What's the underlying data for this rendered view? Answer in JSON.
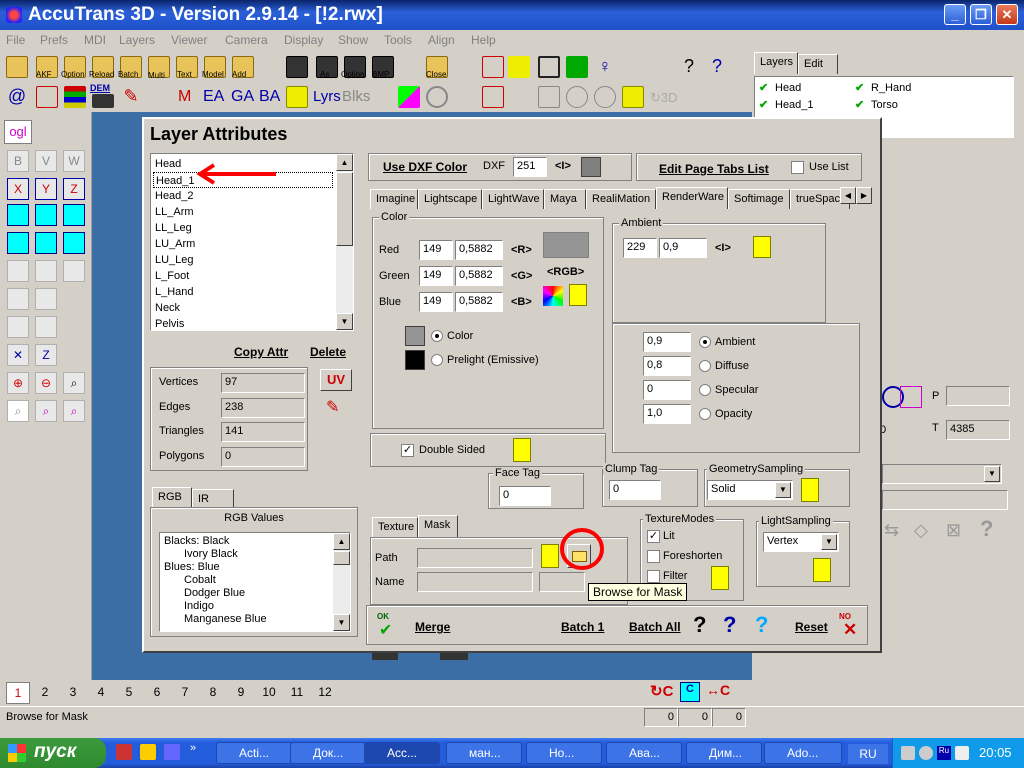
{
  "app": {
    "title": "AccuTrans 3D - Version 2.9.14 - [!2.rwx]",
    "menu": [
      "File",
      "Prefs",
      "MDI",
      "Layers",
      "Viewer",
      "Camera",
      "Display",
      "Show",
      "Tools",
      "Align",
      "Help"
    ],
    "toolbar_labels": [
      "AKF",
      "Option",
      "Reload",
      "Batch",
      "Multi",
      "Text",
      "Model",
      "Add",
      "As",
      "Option",
      "BMP",
      "Close"
    ],
    "toolbar_row2_text": [
      "DEM",
      "EA",
      "GA",
      "BA",
      "Lyrs",
      "Blks"
    ],
    "ogl_label": "ogl"
  },
  "right_panel": {
    "tabs": [
      "Layers",
      "Edit"
    ],
    "layers": [
      {
        "name": "Head",
        "checked": true
      },
      {
        "name": "R_Hand",
        "checked": true
      },
      {
        "name": "Head_1",
        "checked": true
      },
      {
        "name": "Torso",
        "checked": true
      }
    ],
    "p_label": "P",
    "t_label": "T",
    "t_value": "4385",
    "zero_value": "0"
  },
  "dialog": {
    "title": "Layer Attributes",
    "layer_list": [
      "Head",
      "Head_1",
      "Head_2",
      "LL_Arm",
      "LL_Leg",
      "LU_Arm",
      "LU_Leg",
      "L_Foot",
      "L_Hand",
      "Neck",
      "Pelvis"
    ],
    "selected_layer": "Head_1",
    "copy_attr": "Copy Attr",
    "delete": "Delete",
    "uv_label": "UV",
    "stats": [
      {
        "label": "Vertices",
        "value": "97"
      },
      {
        "label": "Edges",
        "value": "238"
      },
      {
        "label": "Triangles",
        "value": "141"
      },
      {
        "label": "Polygons",
        "value": "0"
      }
    ],
    "color_tabs": [
      "RGB",
      "IR"
    ],
    "rgb_values_title": "RGB Values",
    "rgb_list": [
      {
        "text": "Blacks: Black",
        "indent": false
      },
      {
        "text": "Ivory Black",
        "indent": true
      },
      {
        "text": "Blues: Blue",
        "indent": false
      },
      {
        "text": "Cobalt",
        "indent": true
      },
      {
        "text": "Dodger Blue",
        "indent": true
      },
      {
        "text": "Indigo",
        "indent": true
      },
      {
        "text": "Manganese Blue",
        "indent": true
      }
    ],
    "use_dxf_color": "Use DXF Color",
    "dxf_label": "DXF",
    "dxf_value": "251",
    "dxf_arrow": "<I>",
    "edit_page_tabs": "Edit Page Tabs List",
    "use_list": "Use List",
    "format_tabs": [
      "Imagine",
      "Lightscape",
      "LightWave",
      "Maya",
      "RealiMation",
      "RenderWare",
      "Softimage",
      "trueSpac"
    ],
    "active_format_tab": "RenderWare",
    "color_group": {
      "title": "Color",
      "rows": [
        {
          "label": "Red",
          "int": "149",
          "float": "0,5882",
          "btn": "<R>"
        },
        {
          "label": "Green",
          "int": "149",
          "float": "0,5882",
          "btn": "<G>"
        },
        {
          "label": "Blue",
          "int": "149",
          "float": "0,5882",
          "btn": "<B>"
        }
      ],
      "rgb_btn": "<RGB>",
      "swatch_color": "#959595",
      "radio_color": "Color",
      "radio_prelight": "Prelight (Emissive)"
    },
    "ambient_group": {
      "title": "Ambient",
      "int": "229",
      "float": "0,9",
      "btn": "<I>"
    },
    "material": [
      {
        "value": "0,9",
        "label": "Ambient",
        "selected": true
      },
      {
        "value": "0,8",
        "label": "Diffuse",
        "selected": false
      },
      {
        "value": "0",
        "label": "Specular",
        "selected": false
      },
      {
        "value": "1,0",
        "label": "Opacity",
        "selected": false
      }
    ],
    "double_sided": "Double Sided",
    "face_tag_label": "Face Tag",
    "face_tag_value": "0",
    "clump_tag_label": "Clump Tag",
    "clump_tag_value": "0",
    "geometry_sampling_label": "GeometrySampling",
    "geometry_sampling_value": "Solid",
    "texture_tabs": [
      "Texture",
      "Mask"
    ],
    "path_label": "Path",
    "name_label": "Name",
    "texture_modes_title": "TextureModes",
    "texture_modes": [
      {
        "label": "Lit",
        "checked": true
      },
      {
        "label": "Foreshorten",
        "checked": false
      },
      {
        "label": "Filter",
        "checked": false
      }
    ],
    "light_sampling_label": "LightSampling",
    "light_sampling_value": "Vertex",
    "tooltip": "Browse for Mask",
    "ok": "OK",
    "merge": "Merge",
    "batch1": "Batch 1",
    "batch_all": "Batch All",
    "reset": "Reset",
    "no_label": "NO"
  },
  "bottom": {
    "pages": [
      "1",
      "2",
      "3",
      "4",
      "5",
      "6",
      "7",
      "8",
      "9",
      "10",
      "11",
      "12"
    ],
    "status_text": "Browse for Mask",
    "status_values": [
      "0",
      "0",
      "0"
    ]
  },
  "taskbar": {
    "start": "пуск",
    "tasks": [
      "Acti...",
      "Док...",
      "Acc...",
      "ман...",
      "Но...",
      "Ава...",
      "Дим...",
      "Ado..."
    ],
    "lang": "RU",
    "clock": "20:05"
  },
  "colors": {
    "annotation_red": "#ff0000",
    "title_blue": "#0a246a",
    "desktop": "#3a6ea5"
  }
}
